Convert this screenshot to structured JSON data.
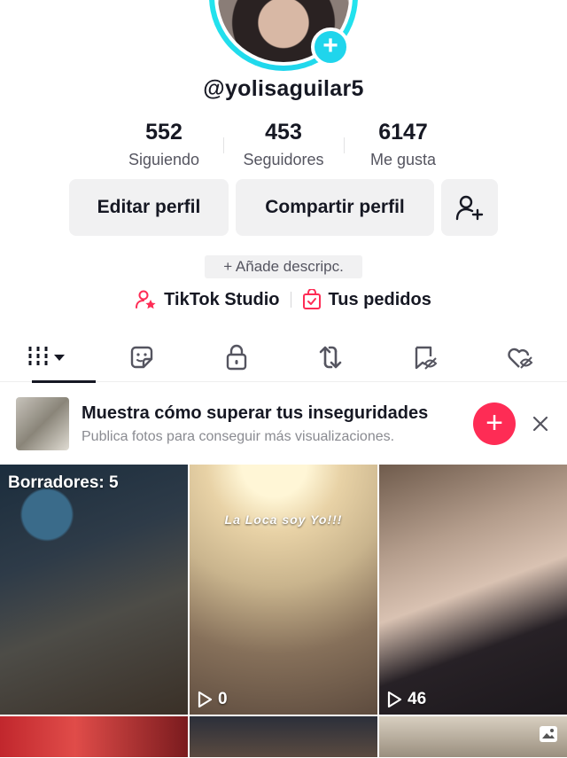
{
  "profile": {
    "username": "@yolisaguilar5"
  },
  "stats": [
    {
      "value": "552",
      "label": "Siguiendo"
    },
    {
      "value": "453",
      "label": "Seguidores"
    },
    {
      "value": "6147",
      "label": "Me gusta"
    }
  ],
  "buttons": {
    "edit": "Editar perfil",
    "share": "Compartir perfil"
  },
  "bio_prompt": "+ Añade descripc.",
  "links": {
    "studio": "TikTok Studio",
    "orders": "Tus pedidos"
  },
  "tabs": [
    "videos-grid-icon",
    "sticker-icon",
    "lock-icon",
    "repost-icon",
    "bookmark-hidden-icon",
    "liked-hidden-icon"
  ],
  "promo": {
    "title": "Muestra cómo superar tus inseguridades",
    "subtitle": "Publica fotos para conseguir más visualizaciones."
  },
  "grid": {
    "drafts_label": "Borradores: 5",
    "caption2": "La Loca soy Yo!!!",
    "views2": "0",
    "views3": "46"
  },
  "colors": {
    "accent": "#fe2c55",
    "ring": "#20d5ec",
    "text": "#161823"
  }
}
